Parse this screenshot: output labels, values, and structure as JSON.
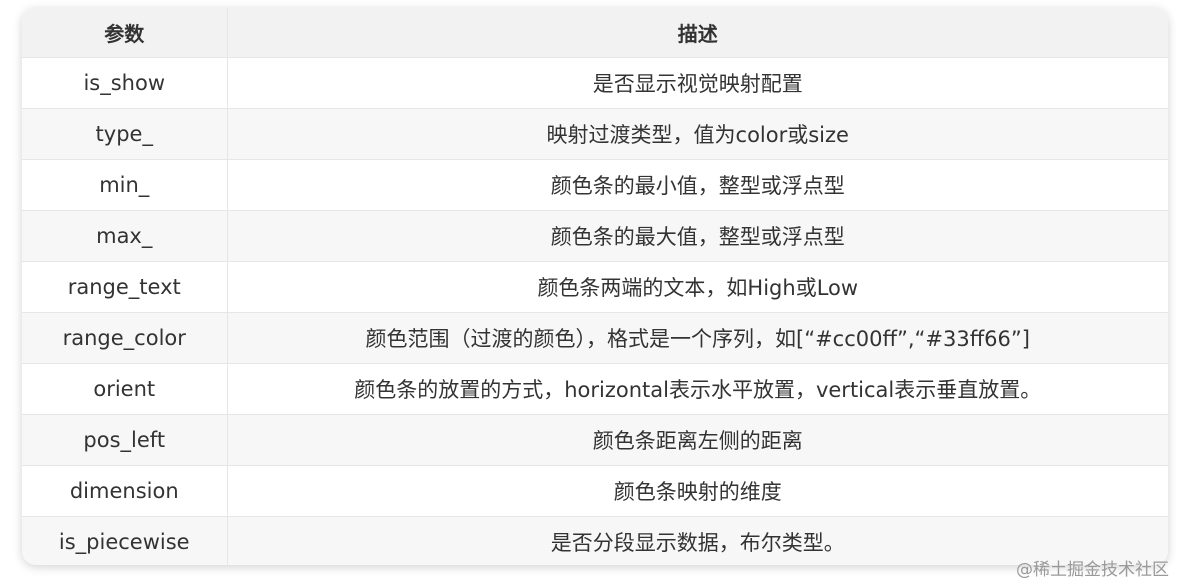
{
  "table": {
    "headers": [
      "参数",
      "描述"
    ],
    "rows": [
      {
        "param": "is_show",
        "desc": "是否显示视觉映射配置"
      },
      {
        "param": "type_",
        "desc": "映射过渡类型，值为color或size"
      },
      {
        "param": "min_",
        "desc": "颜色条的最小值，整型或浮点型"
      },
      {
        "param": "max_",
        "desc": "颜色条的最大值，整型或浮点型"
      },
      {
        "param": "range_text",
        "desc": "颜色条两端的文本，如High或Low"
      },
      {
        "param": "range_color",
        "desc": "颜色范围（过渡的颜色），格式是一个序列，如[“#cc00ff”,“#33ff66”]"
      },
      {
        "param": "orient",
        "desc": "颜色条的放置的方式，horizontal表示水平放置，vertical表示垂直放置。"
      },
      {
        "param": "pos_left",
        "desc": "颜色条距离左侧的距离"
      },
      {
        "param": "dimension",
        "desc": "颜色条映射的维度"
      },
      {
        "param": "is_piecewise",
        "desc": "是否分段显示数据，布尔类型。"
      }
    ]
  },
  "watermark": "@稀土掘金技术社区"
}
